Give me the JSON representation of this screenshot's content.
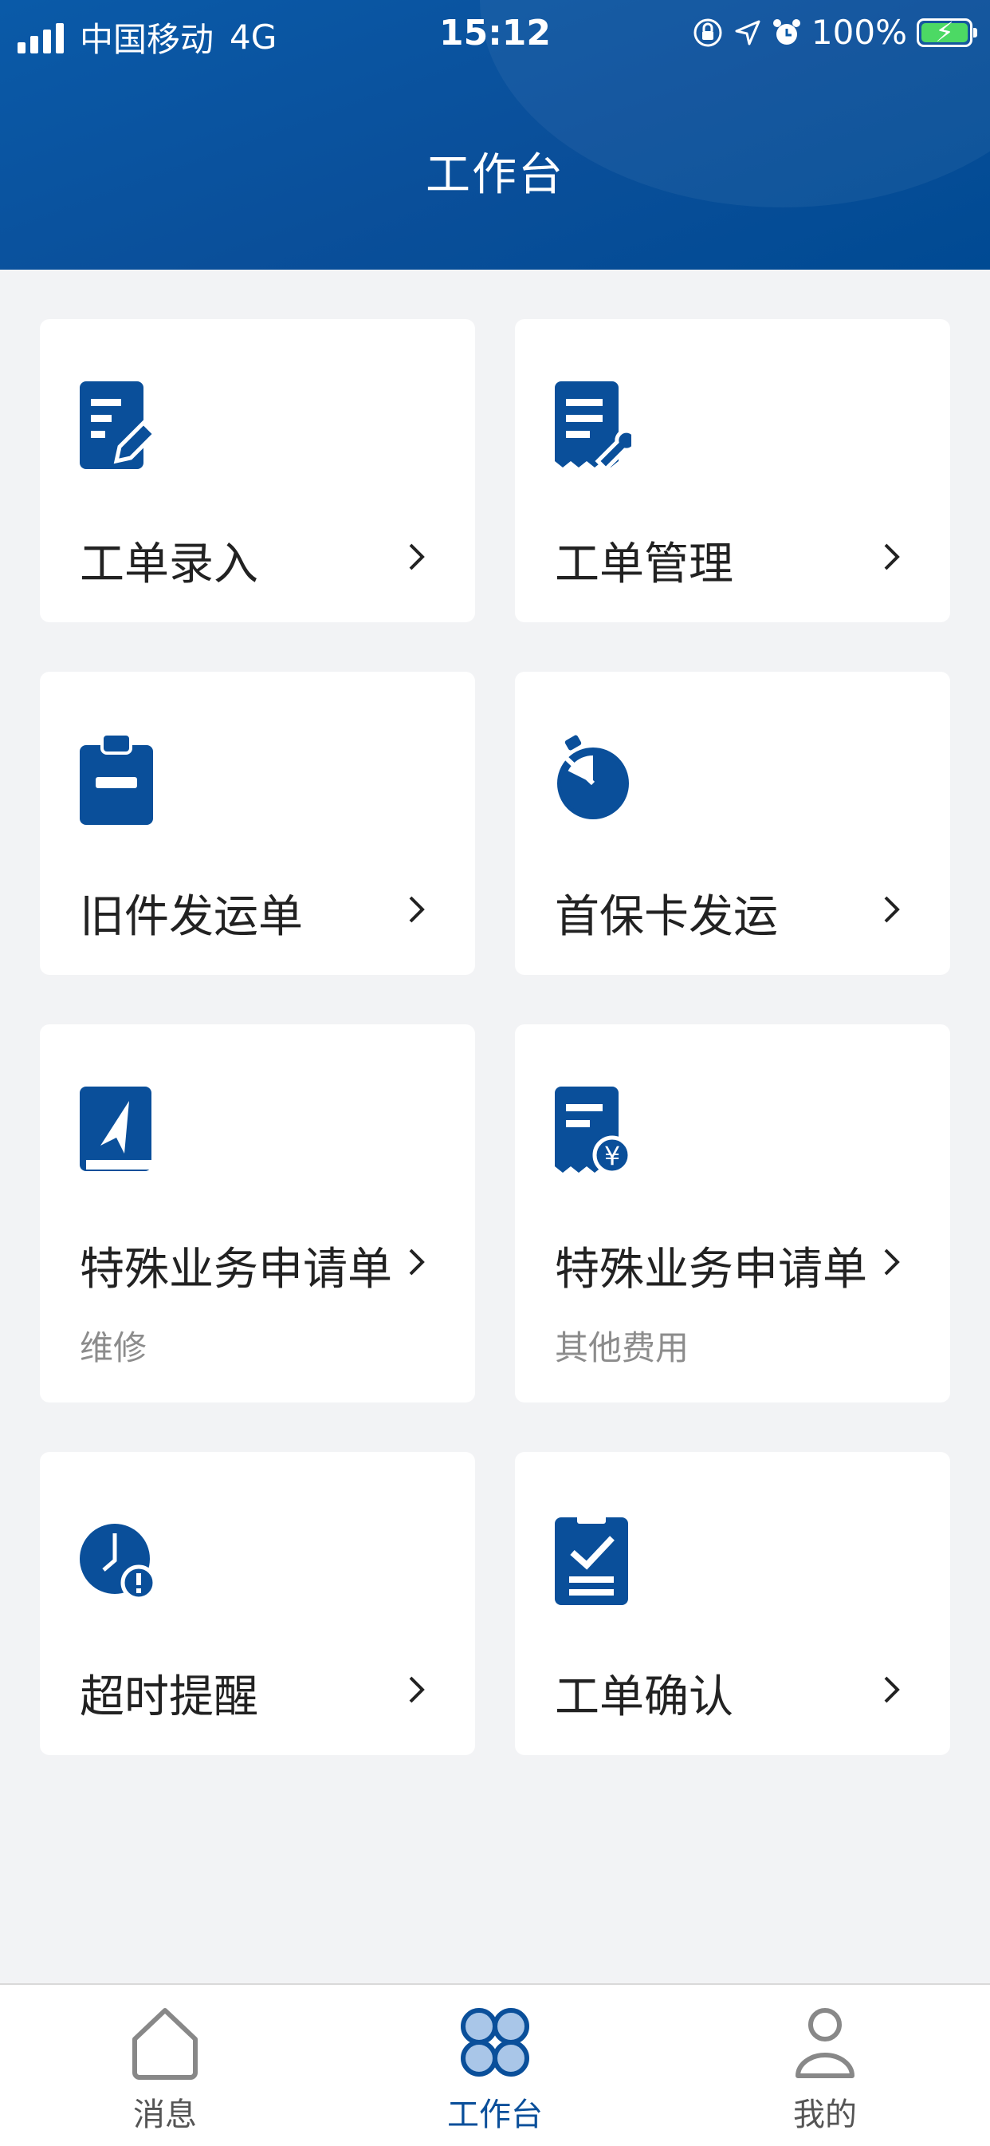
{
  "status_bar": {
    "carrier": "中国移动",
    "network": "4G",
    "time": "15:12",
    "battery": "100%"
  },
  "header": {
    "title": "工作台"
  },
  "cards": [
    {
      "label": "工单录入",
      "sub": "",
      "icon": "edit-document-icon"
    },
    {
      "label": "工单管理",
      "sub": "",
      "icon": "document-wrench-icon"
    },
    {
      "label": "旧件发运单",
      "sub": "",
      "icon": "clipboard-icon"
    },
    {
      "label": "首保卡发运",
      "sub": "",
      "icon": "stopwatch-icon"
    },
    {
      "label": "特殊业务申请单",
      "sub": "维修",
      "icon": "book-navigation-icon"
    },
    {
      "label": "特殊业务申请单",
      "sub": "其他费用",
      "icon": "document-yuan-icon"
    },
    {
      "label": "超时提醒",
      "sub": "",
      "icon": "clock-alert-icon"
    },
    {
      "label": "工单确认",
      "sub": "",
      "icon": "clipboard-check-icon"
    }
  ],
  "tabbar": {
    "items": [
      {
        "label": "消息",
        "icon": "home-icon",
        "active": false
      },
      {
        "label": "工作台",
        "icon": "workbench-icon",
        "active": true
      },
      {
        "label": "我的",
        "icon": "user-icon",
        "active": false
      }
    ]
  },
  "colors": {
    "brand": "#0a4f9a",
    "background": "#f2f3f5",
    "card": "#ffffff",
    "text": "#222222",
    "subtext": "#8c8c8c",
    "tab_inactive": "#555555"
  }
}
